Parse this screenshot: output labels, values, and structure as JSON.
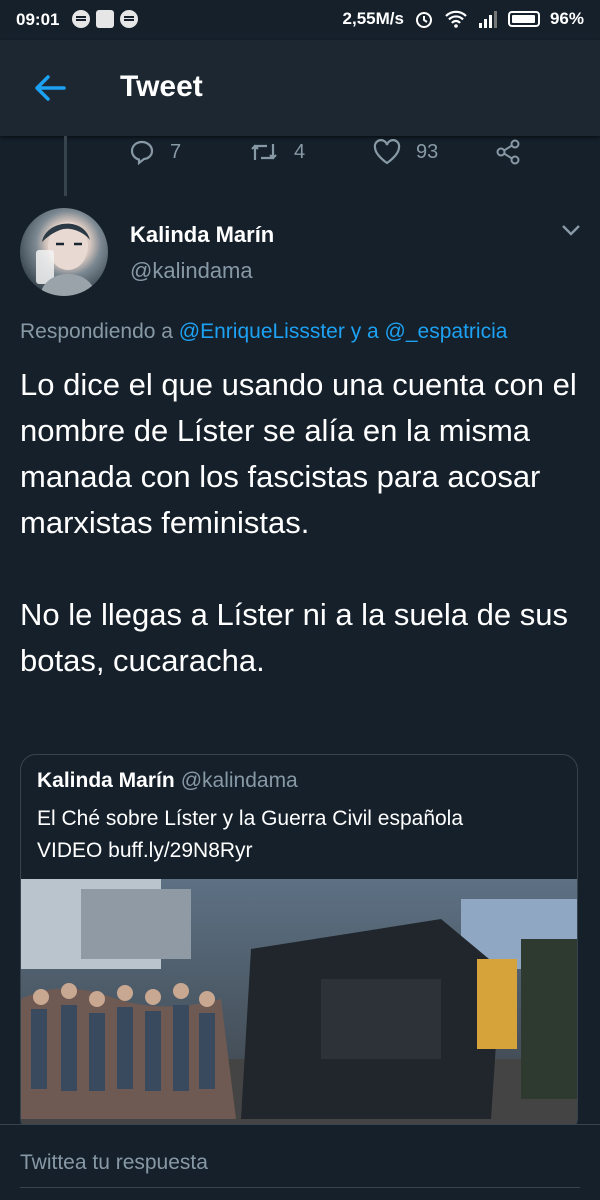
{
  "status_bar": {
    "time": "09:01",
    "network_speed": "2,55M/s",
    "battery": "96%"
  },
  "header": {
    "title": "Tweet"
  },
  "actions": {
    "replies": "7",
    "retweets": "4",
    "likes": "93"
  },
  "tweet": {
    "author_name": "Kalinda Marín",
    "author_handle": "@kalindama",
    "replying_prefix": "Respondiendo a ",
    "reply_user_1": "@EnriqueLissster",
    "reply_joiner": " y a ",
    "reply_user_2": "@_espatricia",
    "text_p1": "Lo dice el que usando una cuenta con el nombre de Líster se alía en la misma manada con los fascistas para acosar marxistas feministas.",
    "text_p2": "No le llegas a Líster ni a la suela de sus botas, cucaracha."
  },
  "quoted_tweet": {
    "author_name": "Kalinda Marín",
    "author_handle": "@kalindama",
    "text_line1": "El Ché sobre Líster y la Guerra Civil española",
    "text_line2": "VIDEO buff.ly/29N8Ryr"
  },
  "compose": {
    "placeholder": "Twittea tu respuesta"
  },
  "colors": {
    "background": "#15202b",
    "header": "#1c2732",
    "accent": "#1da1f2",
    "secondary_text": "#8899a6",
    "border": "#38444d"
  }
}
